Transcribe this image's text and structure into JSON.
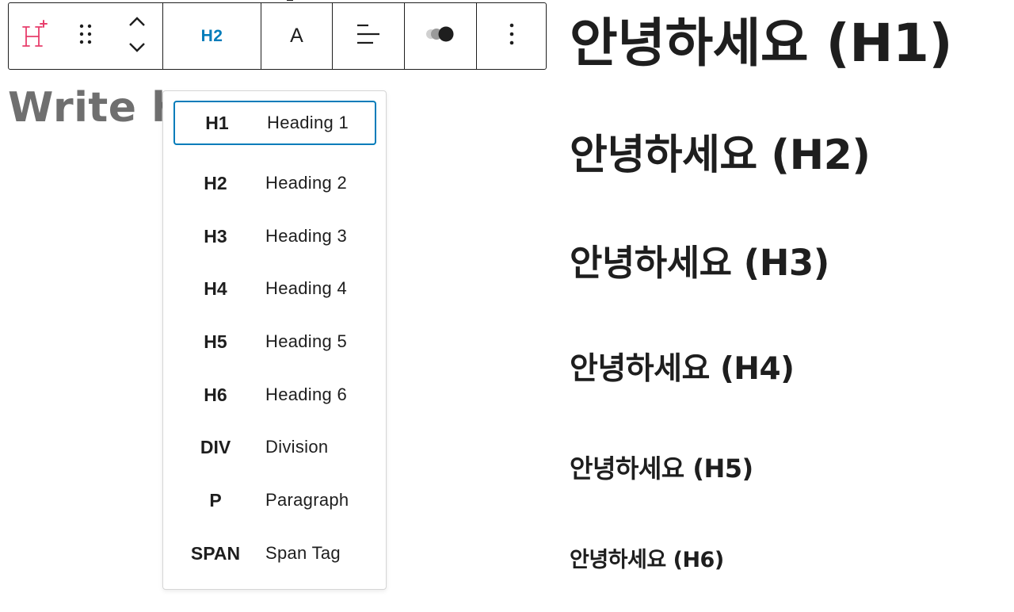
{
  "toolbar": {
    "plugin_icon": "heading-plus-icon",
    "level_label": "H2",
    "font_label": "A",
    "accent_color": "#007cba",
    "brand_color": "#e83e6c"
  },
  "editor": {
    "placeholder": "Write h"
  },
  "dropdown": {
    "items": [
      {
        "tag": "H1",
        "label": "Heading 1"
      },
      {
        "tag": "H2",
        "label": "Heading 2"
      },
      {
        "tag": "H3",
        "label": "Heading 3"
      },
      {
        "tag": "H4",
        "label": "Heading 4"
      },
      {
        "tag": "H5",
        "label": "Heading 5"
      },
      {
        "tag": "H6",
        "label": "Heading 6"
      },
      {
        "tag": "DIV",
        "label": "Division"
      },
      {
        "tag": "P",
        "label": "Paragraph"
      },
      {
        "tag": "SPAN",
        "label": "Span Tag"
      }
    ],
    "selected_index": 0
  },
  "preview": {
    "h1": "안녕하세요 (H1)",
    "h2": "안녕하세요 (H2)",
    "h3": "안녕하세요 (H3)",
    "h4": "안녕하세요 (H4)",
    "h5": "안녕하세요 (H5)",
    "h6": "안녕하세요 (H6)"
  }
}
